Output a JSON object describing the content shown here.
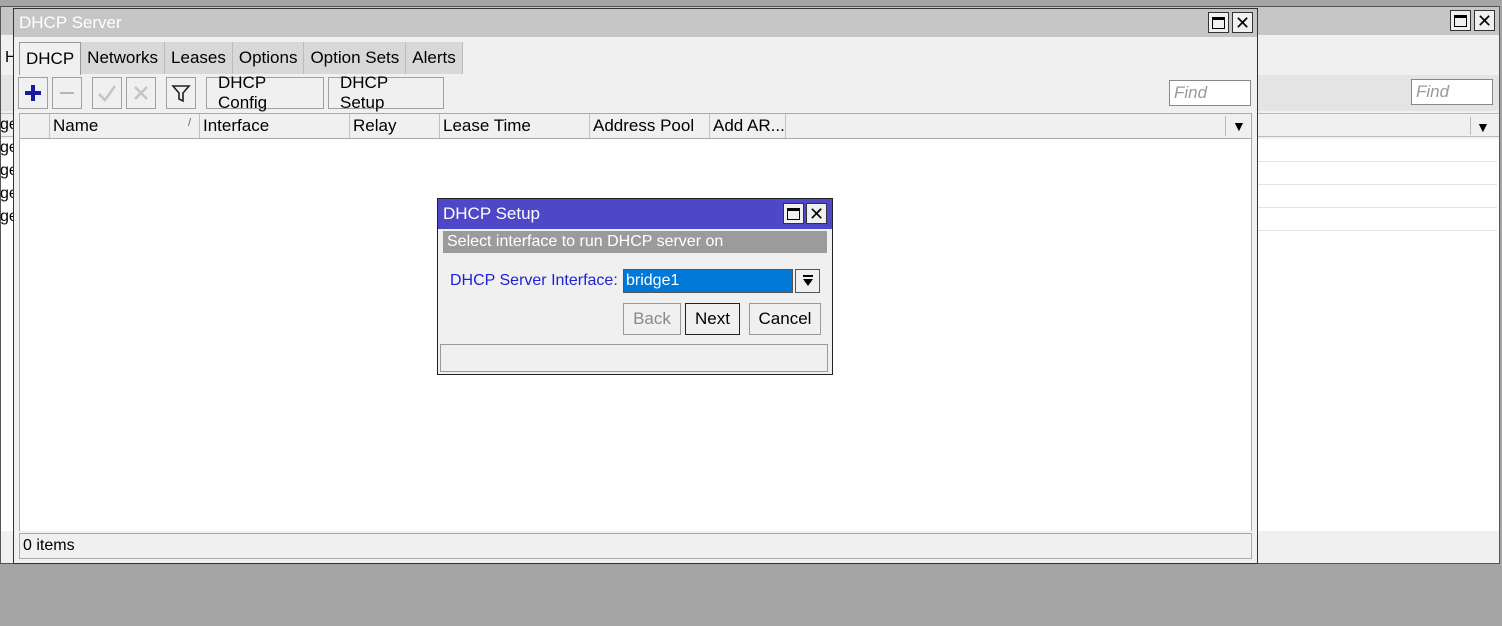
{
  "background_window": {
    "find_placeholder": "Find",
    "left_slice_text": "H",
    "left_row_fragments": [
      "ge",
      "ge",
      "ge",
      "ge",
      "ge"
    ]
  },
  "window": {
    "title": "DHCP Server",
    "tabs": [
      "DHCP",
      "Networks",
      "Leases",
      "Options",
      "Option Sets",
      "Alerts"
    ],
    "active_tab": "DHCP",
    "toolbar": {
      "add_icon": "plus-icon",
      "remove_icon": "minus-icon",
      "enable_icon": "check-icon",
      "disable_icon": "cross-icon",
      "filter_icon": "filter-icon",
      "dhcp_config_label": "DHCP Config",
      "dhcp_setup_label": "DHCP Setup",
      "find_placeholder": "Find"
    },
    "columns": [
      "Name",
      "Interface",
      "Relay",
      "Lease Time",
      "Address Pool",
      "Add AR..."
    ],
    "sort_indicator": "/",
    "status": "0 items"
  },
  "dialog": {
    "title": "DHCP Setup",
    "subtitle": "Select interface to run DHCP server on",
    "field_label": "DHCP Server Interface:",
    "field_value": "bridge1",
    "back_label": "Back",
    "next_label": "Next",
    "cancel_label": "Cancel"
  },
  "colors": {
    "dialog_titlebar": "#4e48c9",
    "selection": "#0078d7",
    "label_blue": "#1f21d6",
    "add_icon": "#1a1aa6"
  }
}
